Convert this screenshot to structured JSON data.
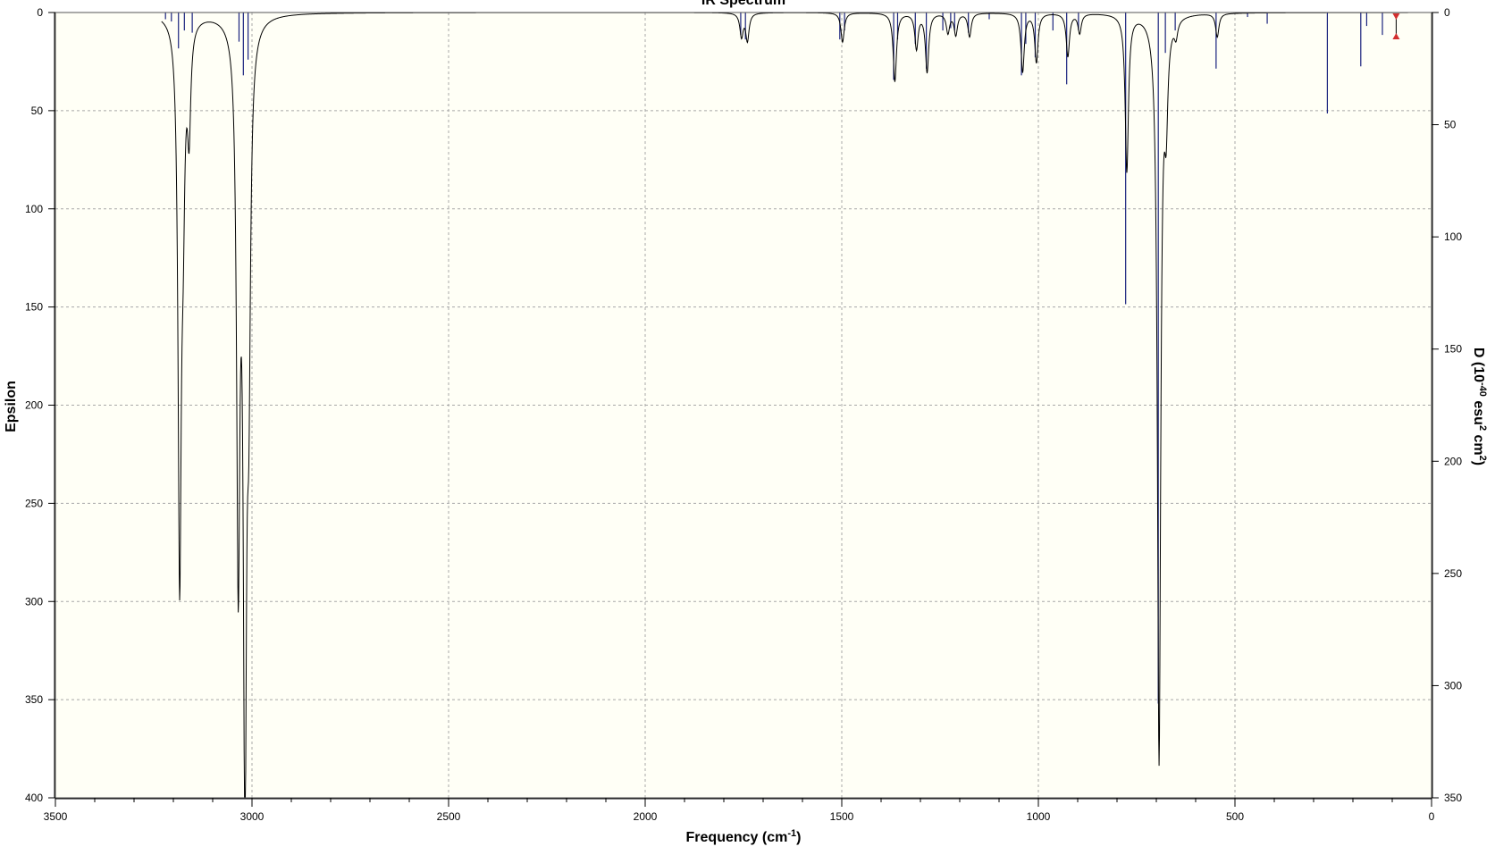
{
  "chart_data": {
    "type": "line",
    "title": "IR Spectrum",
    "xlabel": "Frequency (cm",
    "xlabel_sup": "-1",
    "xlabel_end": ")",
    "ylabel_left": "Epsilon",
    "ylabel_right_parts": [
      "D (10",
      "-40",
      " esu",
      "2",
      " cm",
      "2",
      ")"
    ],
    "xlim": [
      3500,
      0
    ],
    "ylim_left": [
      0,
      400
    ],
    "ylim_right": [
      0,
      350
    ],
    "inverted_y": true,
    "grid": true,
    "x_ticks": [
      3500,
      3000,
      2500,
      2000,
      1500,
      1000,
      500,
      0
    ],
    "y_ticks_left": [
      0,
      50,
      100,
      150,
      200,
      250,
      300,
      350,
      400
    ],
    "y_ticks_right": [
      0,
      50,
      100,
      150,
      200,
      250,
      300,
      350
    ],
    "spectrum_peaks": [
      {
        "x": 3184,
        "epsilon": 280
      },
      {
        "x": 3175,
        "epsilon": 70
      },
      {
        "x": 3160,
        "epsilon": 52
      },
      {
        "x": 3035,
        "epsilon": 270
      },
      {
        "x": 3018,
        "epsilon": 380
      },
      {
        "x": 3008,
        "epsilon": 145
      },
      {
        "x": 1755,
        "epsilon": 12
      },
      {
        "x": 1740,
        "epsilon": 14
      },
      {
        "x": 1498,
        "epsilon": 15
      },
      {
        "x": 1365,
        "epsilon": 35
      },
      {
        "x": 1310,
        "epsilon": 18
      },
      {
        "x": 1283,
        "epsilon": 30
      },
      {
        "x": 1230,
        "epsilon": 10
      },
      {
        "x": 1210,
        "epsilon": 11
      },
      {
        "x": 1175,
        "epsilon": 12
      },
      {
        "x": 1040,
        "epsilon": 30
      },
      {
        "x": 1005,
        "epsilon": 25
      },
      {
        "x": 925,
        "epsilon": 22
      },
      {
        "x": 895,
        "epsilon": 10
      },
      {
        "x": 775,
        "epsilon": 80
      },
      {
        "x": 693,
        "epsilon": 380
      },
      {
        "x": 675,
        "epsilon": 45
      },
      {
        "x": 650,
        "epsilon": 8
      },
      {
        "x": 545,
        "epsilon": 12
      }
    ],
    "stick_peaks": [
      {
        "x": 3220,
        "d": 3
      },
      {
        "x": 3205,
        "d": 4
      },
      {
        "x": 3187,
        "d": 16
      },
      {
        "x": 3172,
        "d": 8
      },
      {
        "x": 3152,
        "d": 9
      },
      {
        "x": 3033,
        "d": 13
      },
      {
        "x": 3022,
        "d": 28
      },
      {
        "x": 3010,
        "d": 21
      },
      {
        "x": 1757,
        "d": 10
      },
      {
        "x": 1745,
        "d": 12
      },
      {
        "x": 1505,
        "d": 12
      },
      {
        "x": 1493,
        "d": 8
      },
      {
        "x": 1368,
        "d": 30
      },
      {
        "x": 1358,
        "d": 12
      },
      {
        "x": 1313,
        "d": 14
      },
      {
        "x": 1285,
        "d": 25
      },
      {
        "x": 1243,
        "d": 8
      },
      {
        "x": 1223,
        "d": 7
      },
      {
        "x": 1213,
        "d": 8
      },
      {
        "x": 1178,
        "d": 9
      },
      {
        "x": 1125,
        "d": 3
      },
      {
        "x": 1043,
        "d": 28
      },
      {
        "x": 1032,
        "d": 14
      },
      {
        "x": 1008,
        "d": 20
      },
      {
        "x": 963,
        "d": 8
      },
      {
        "x": 928,
        "d": 32
      },
      {
        "x": 898,
        "d": 8
      },
      {
        "x": 778,
        "d": 130
      },
      {
        "x": 695,
        "d": 308
      },
      {
        "x": 677,
        "d": 18
      },
      {
        "x": 652,
        "d": 8
      },
      {
        "x": 548,
        "d": 25
      },
      {
        "x": 468,
        "d": 2
      },
      {
        "x": 418,
        "d": 5
      },
      {
        "x": 265,
        "d": 45
      },
      {
        "x": 180,
        "d": 24
      },
      {
        "x": 165,
        "d": 6
      },
      {
        "x": 125,
        "d": 10
      }
    ],
    "marker_x": 90,
    "colors": {
      "plot_bg": "#fffff6",
      "spectrum_line": "#000000",
      "stick_line": "#1a237e",
      "grid": "#a8a8a8",
      "marker": "#d32f2f"
    }
  }
}
